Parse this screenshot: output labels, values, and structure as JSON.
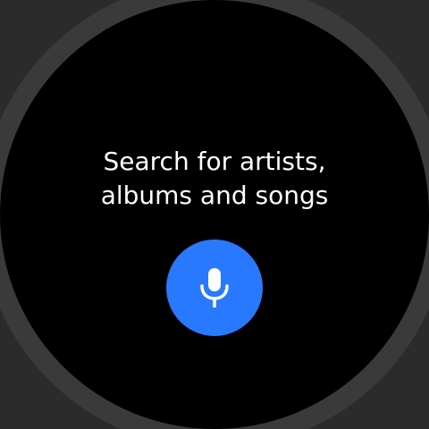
{
  "prompt": {
    "line1": "Search for artists,",
    "line2": "albums and songs"
  },
  "voice_search": {
    "icon": "microphone-icon",
    "accent_color": "#2979ff"
  },
  "colors": {
    "screen": "#000000",
    "text": "#ffffff",
    "bezel": "#3a3a3a",
    "background": "#2b2b2b"
  }
}
